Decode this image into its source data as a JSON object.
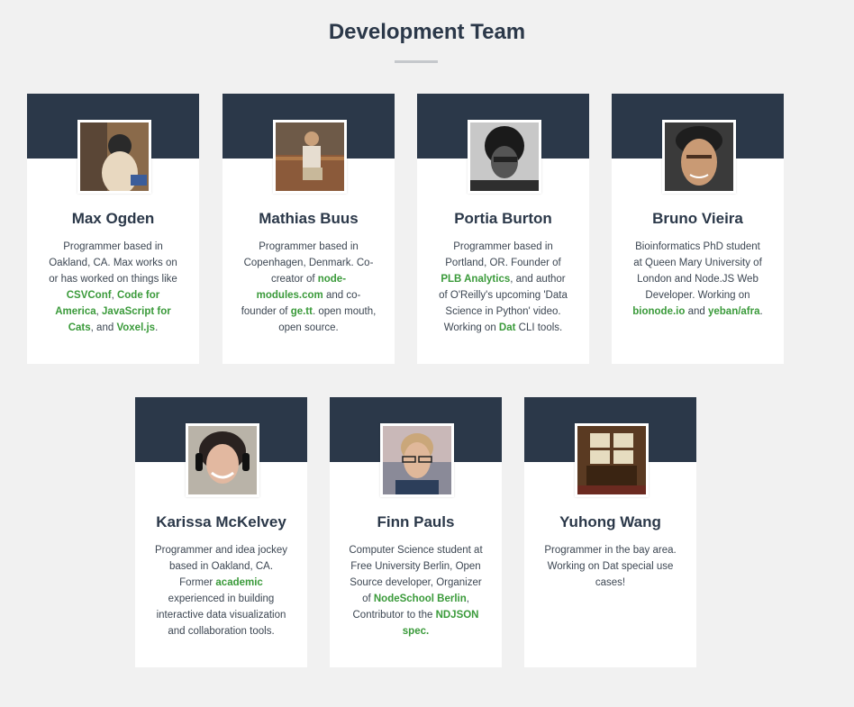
{
  "page": {
    "title": "Development Team"
  },
  "members": [
    {
      "name": "Max Ogden",
      "bio": [
        {
          "t": "Programmer based in Oakland, CA. Max works on or has worked on things like "
        },
        {
          "t": "CSVConf",
          "link": true
        },
        {
          "t": ", "
        },
        {
          "t": "Code for America",
          "link": true
        },
        {
          "t": ", "
        },
        {
          "t": "JavaScript for Cats",
          "link": true
        },
        {
          "t": ", and "
        },
        {
          "t": "Voxel.js",
          "link": true
        },
        {
          "t": "."
        }
      ]
    },
    {
      "name": "Mathias Buus",
      "bio": [
        {
          "t": "Programmer based in Copenhagen, Denmark. Co-creator of "
        },
        {
          "t": "node-modules.com",
          "link": true
        },
        {
          "t": " and co-founder of "
        },
        {
          "t": "ge.tt",
          "link": true
        },
        {
          "t": ". open mouth, open source."
        }
      ]
    },
    {
      "name": "Portia Burton",
      "bio": [
        {
          "t": "Programmer based in Portland, OR. Founder of "
        },
        {
          "t": "PLB Analytics",
          "link": true
        },
        {
          "t": ", and author of O'Reilly's upcoming 'Data Science in Python' video. Working on "
        },
        {
          "t": "Dat",
          "link": true
        },
        {
          "t": " CLI tools."
        }
      ]
    },
    {
      "name": "Bruno Vieira",
      "bio": [
        {
          "t": "Bioinformatics PhD student at Queen Mary University of London and Node.JS Web Developer. Working on "
        },
        {
          "t": "bionode.io",
          "link": true
        },
        {
          "t": " and "
        },
        {
          "t": "yeban/afra",
          "link": true
        },
        {
          "t": "."
        }
      ]
    },
    {
      "name": "Karissa McKelvey",
      "bio": [
        {
          "t": "Programmer and idea jockey based in Oakland, CA. Former "
        },
        {
          "t": "academic",
          "link": true
        },
        {
          "t": " experienced in building interactive data visualization and collaboration tools."
        }
      ]
    },
    {
      "name": "Finn Pauls",
      "bio": [
        {
          "t": "Computer Science student at Free University Berlin, Open Source developer, Organizer of "
        },
        {
          "t": "NodeSchool Berlin",
          "link": true
        },
        {
          "t": ", Contributor to the "
        },
        {
          "t": "NDJSON spec.",
          "link": true
        }
      ]
    },
    {
      "name": "Yuhong Wang",
      "bio": [
        {
          "t": "Programmer in the bay area. Working on Dat special use cases!"
        }
      ]
    }
  ],
  "colors": {
    "background": "#f1f1f1",
    "header_band": "#2b3849",
    "link": "#3a9a3a",
    "title": "#2b3849"
  }
}
